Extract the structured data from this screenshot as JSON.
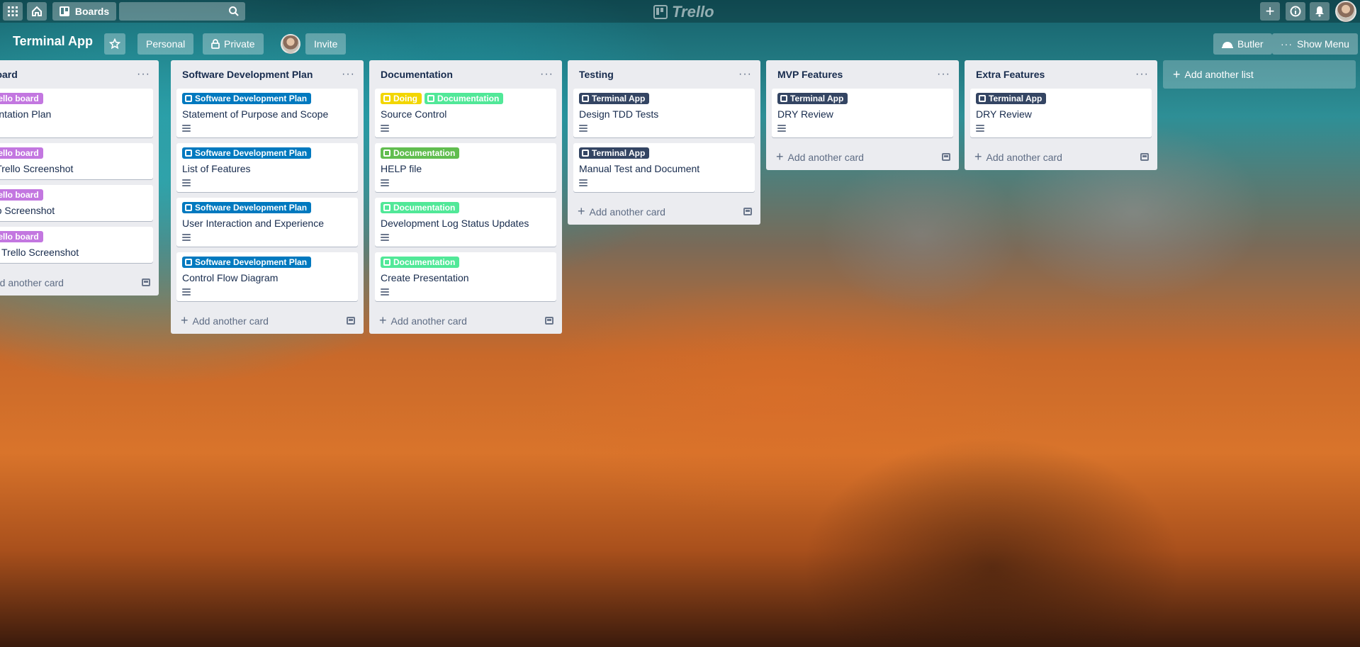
{
  "topbar": {
    "boards_label": "Boards",
    "logo_text": "Trello"
  },
  "board": {
    "title": "Terminal App",
    "team_label": "Personal",
    "visibility_label": "Private",
    "invite_label": "Invite",
    "butler_label": "Butler",
    "menu_label": "Show Menu"
  },
  "colors": {
    "purple": "#c377e0",
    "blue": "#0079bf",
    "navy": "#344563",
    "green": "#61bd4f",
    "lime": "#51e898",
    "yellow": "#f2d600"
  },
  "lists": [
    {
      "title": "lo Board",
      "cards": [
        {
          "labels": [
            {
              "text": "Trello board",
              "color": "#c377e0"
            }
          ],
          "title": "lementation Plan",
          "has_desc": true
        },
        {
          "labels": [
            {
              "text": "Trello board",
              "color": "#c377e0"
            }
          ],
          "title": "ting Trello Screenshot",
          "has_desc": false
        },
        {
          "labels": [
            {
              "text": "Trello board",
              "color": "#c377e0"
            }
          ],
          "title": " Trello Screenshot",
          "has_desc": false
        },
        {
          "labels": [
            {
              "text": "Trello board",
              "color": "#c377e0"
            }
          ],
          "title": "shed Trello Screenshot",
          "has_desc": false
        }
      ],
      "add_card": "Add another card"
    },
    {
      "title": "Software Development Plan",
      "cards": [
        {
          "labels": [
            {
              "text": "Software Development Plan",
              "color": "#0079bf"
            }
          ],
          "title": "Statement of Purpose and Scope",
          "has_desc": true
        },
        {
          "labels": [
            {
              "text": "Software Development Plan",
              "color": "#0079bf"
            }
          ],
          "title": "List of Features",
          "has_desc": true
        },
        {
          "labels": [
            {
              "text": "Software Development Plan",
              "color": "#0079bf"
            }
          ],
          "title": "User Interaction and Experience",
          "has_desc": true
        },
        {
          "labels": [
            {
              "text": "Software Development Plan",
              "color": "#0079bf"
            }
          ],
          "title": "Control Flow Diagram",
          "has_desc": true
        }
      ],
      "add_card": "Add another card"
    },
    {
      "title": "Documentation",
      "cards": [
        {
          "labels": [
            {
              "text": "Doing",
              "color": "#f2d600"
            },
            {
              "text": "Documentation",
              "color": "#51e898"
            }
          ],
          "title": "Source Control",
          "has_desc": true
        },
        {
          "labels": [
            {
              "text": "Documentation",
              "color": "#61bd4f"
            }
          ],
          "title": "HELP file",
          "has_desc": true
        },
        {
          "labels": [
            {
              "text": "Documentation",
              "color": "#51e898"
            }
          ],
          "title": "Development Log Status Updates",
          "has_desc": true
        },
        {
          "labels": [
            {
              "text": "Documentation",
              "color": "#51e898"
            }
          ],
          "title": "Create Presentation",
          "has_desc": true
        }
      ],
      "add_card": "Add another card"
    },
    {
      "title": "Testing",
      "cards": [
        {
          "labels": [
            {
              "text": "Terminal App",
              "color": "#344563"
            }
          ],
          "title": "Design TDD Tests",
          "has_desc": true
        },
        {
          "labels": [
            {
              "text": "Terminal App",
              "color": "#344563"
            }
          ],
          "title": "Manual Test and Document",
          "has_desc": true
        }
      ],
      "add_card": "Add another card"
    },
    {
      "title": "MVP Features",
      "cards": [
        {
          "labels": [
            {
              "text": "Terminal App",
              "color": "#344563"
            }
          ],
          "title": "DRY Review",
          "has_desc": true
        }
      ],
      "add_card": "Add another card"
    },
    {
      "title": "Extra Features",
      "cards": [
        {
          "labels": [
            {
              "text": "Terminal App",
              "color": "#344563"
            }
          ],
          "title": "DRY Review",
          "has_desc": true
        }
      ],
      "add_card": "Add another card"
    }
  ],
  "add_list": "Add another list"
}
